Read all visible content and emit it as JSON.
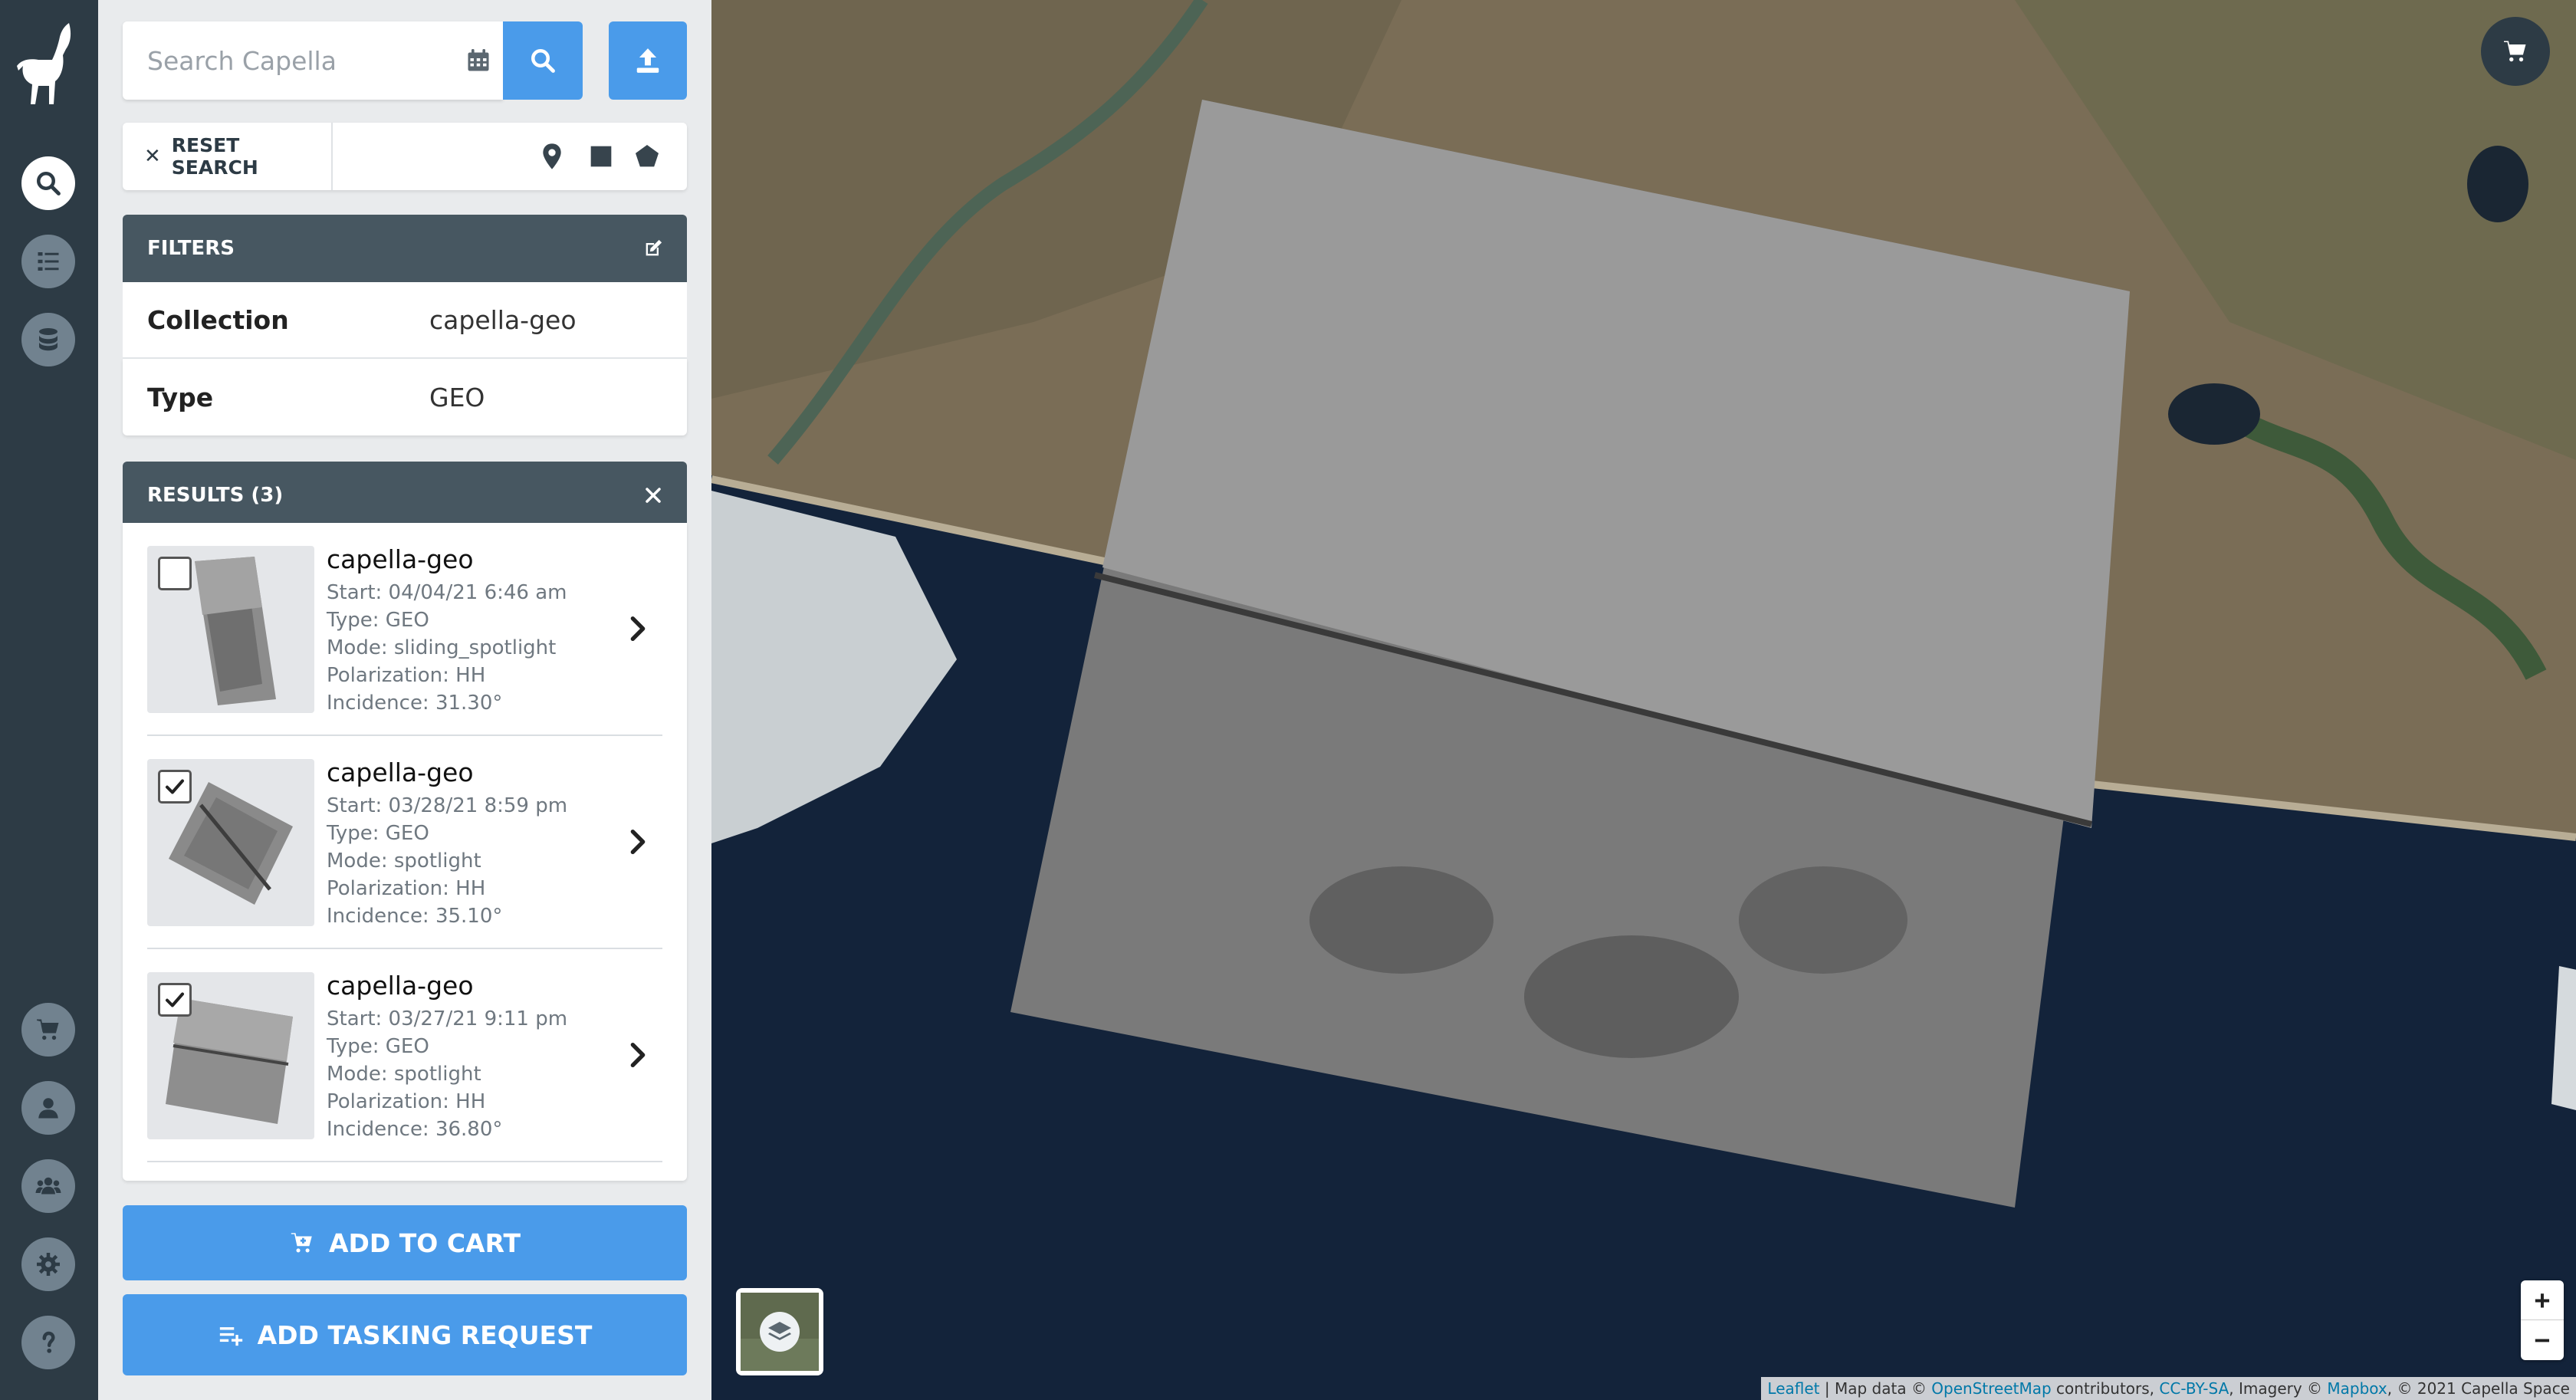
{
  "rail": {
    "items": [
      {
        "name": "search"
      },
      {
        "name": "tasks"
      },
      {
        "name": "collections"
      },
      {
        "name": "cart"
      },
      {
        "name": "account"
      },
      {
        "name": "team"
      },
      {
        "name": "settings"
      },
      {
        "name": "help"
      }
    ]
  },
  "search": {
    "placeholder": "Search Capella",
    "reset_label": "RESET SEARCH"
  },
  "filters": {
    "title": "FILTERS",
    "rows": [
      {
        "key": "Collection",
        "value": "capella-geo"
      },
      {
        "key": "Type",
        "value": "GEO"
      }
    ]
  },
  "results": {
    "title": "RESULTS (3)",
    "items": [
      {
        "title": "capella-geo",
        "start": "Start: 04/04/21 6:46 am",
        "type": "Type: GEO",
        "mode": "Mode: sliding_spotlight",
        "polarization": "Polarization: HH",
        "incidence": "Incidence: 31.30°",
        "checked": false
      },
      {
        "title": "capella-geo",
        "start": "Start: 03/28/21 8:59 pm",
        "type": "Type: GEO",
        "mode": "Mode: spotlight",
        "polarization": "Polarization: HH",
        "incidence": "Incidence: 35.10°",
        "checked": true
      },
      {
        "title": "capella-geo",
        "start": "Start: 03/27/21 9:11 pm",
        "type": "Type: GEO",
        "mode": "Mode: spotlight",
        "polarization": "Polarization: HH",
        "incidence": "Incidence: 36.80°",
        "checked": true
      }
    ]
  },
  "actions": {
    "add_to_cart": "ADD TO CART",
    "add_tasking": "ADD TASKING REQUEST"
  },
  "map": {
    "zoom_in": "+",
    "zoom_out": "−",
    "attribution": {
      "leaflet": "Leaflet",
      "sep1": " | Map data © ",
      "osm": "OpenStreetMap",
      "sep2": " contributors, ",
      "ccbysa": "CC-BY-SA",
      "sep3": ", Imagery © ",
      "mapbox": "Mapbox",
      "sep4": ", © 2021 Capella Space"
    }
  },
  "colors": {
    "rail_bg": "#2d3b45",
    "panel_bg": "#e9ebed",
    "accent": "#4a9bea",
    "header_bg": "#475761"
  }
}
